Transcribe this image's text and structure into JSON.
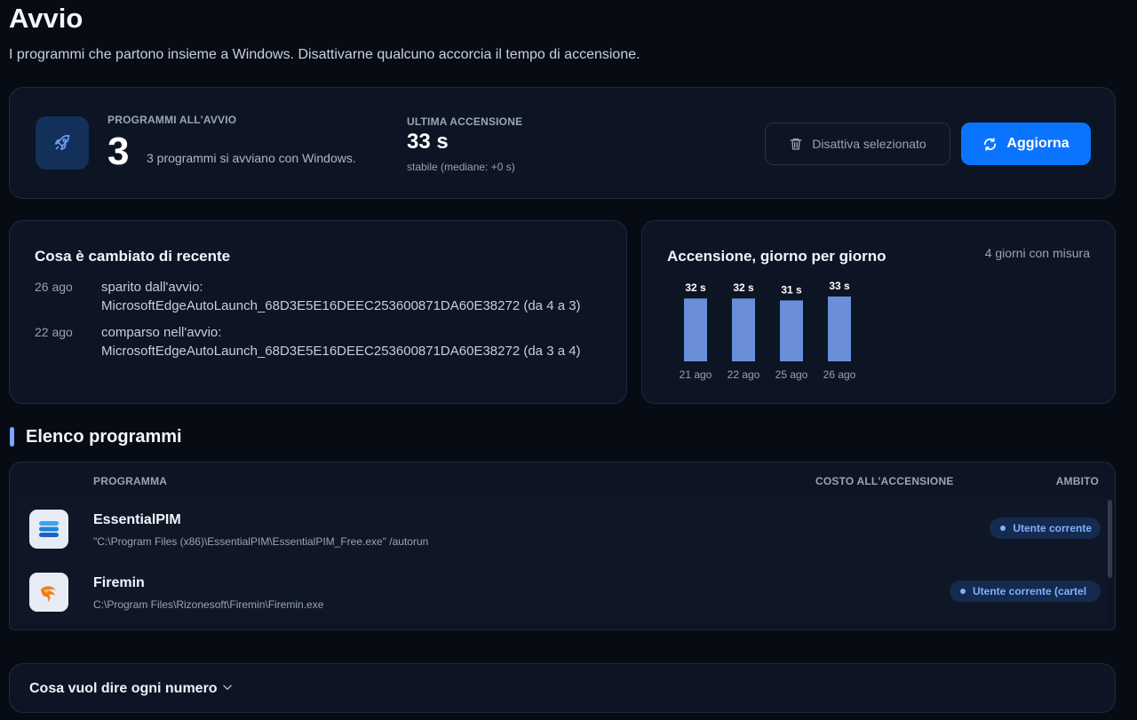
{
  "page": {
    "title": "Avvio",
    "subtitle": "I programmi che partono insieme a Windows. Disattivarne qualcuno accorcia il tempo di accensione."
  },
  "summary": {
    "startup_label": "PROGRAMMI ALL'AVVIO",
    "startup_count": "3",
    "startup_note": "3 programmi si avviano con Windows.",
    "boot_label": "ULTIMA ACCENSIONE",
    "boot_value": "33 s",
    "boot_note": "stabile (mediane: +0 s)",
    "disable_button": "Disattiva selezionato",
    "refresh_button": "Aggiorna",
    "accent_color": "#0a74ff"
  },
  "changes": {
    "title": "Cosa è cambiato di recente",
    "items": [
      {
        "date": "26 ago",
        "line1": "sparito dall'avvio:",
        "line2": "MicrosoftEdgeAutoLaunch_68D3E5E16DEEC253600871DA60E38272 (da 4 a 3)"
      },
      {
        "date": "22 ago",
        "line1": "comparso nell'avvio:",
        "line2": "MicrosoftEdgeAutoLaunch_68D3E5E16DEEC253600871DA60E38272 (da 3 a 4)"
      }
    ]
  },
  "chart_card": {
    "title": "Accensione, giorno per giorno",
    "meta": "4 giorni con misura"
  },
  "chart_data": {
    "type": "bar",
    "categories": [
      "21 ago",
      "22 ago",
      "25 ago",
      "26 ago"
    ],
    "values": [
      32,
      32,
      31,
      33
    ],
    "data_labels": [
      "32 s",
      "32 s",
      "31 s",
      "33 s"
    ],
    "bar_color": "#6a8fd8",
    "title": "Accensione, giorno per giorno"
  },
  "programs": {
    "section_title": "Elenco programmi",
    "columns": {
      "program": "PROGRAMMA",
      "cost": "COSTO ALL'ACCENSIONE",
      "scope": "AMBITO"
    },
    "rows": [
      {
        "name": "EssentialPIM",
        "path": "\"C:\\Program Files (x86)\\EssentialPIM\\EssentialPIM_Free.exe\" /autorun",
        "scope": "Utente corrente",
        "icon": "essentialpim-icon"
      },
      {
        "name": "Firemin",
        "path": "C:\\Program Files\\Rizonesoft\\Firemin\\Firemin.exe",
        "scope": "Utente corrente (cartel",
        "icon": "firemin-icon"
      }
    ]
  },
  "footer": {
    "accordion_label": "Cosa vuol dire ogni numero"
  }
}
